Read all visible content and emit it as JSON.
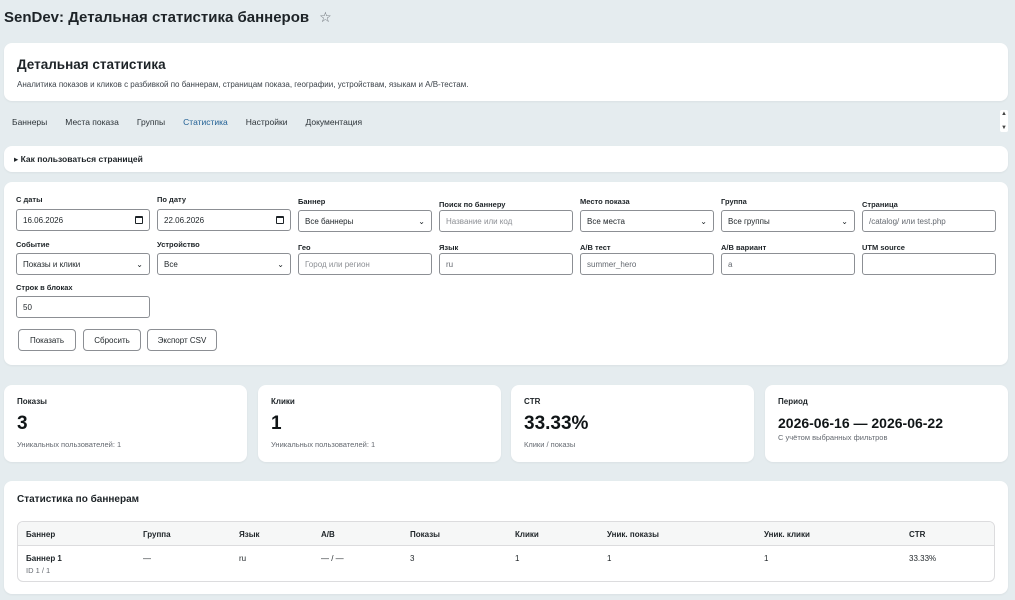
{
  "page_title": "SenDev: Детальная статистика баннеров",
  "header": {
    "title": "Детальная статистика",
    "subtitle": "Аналитика показов и кликов с разбивкой по баннерам, страницам показа, географии, устройствам, языкам и A/B-тестам."
  },
  "tabs": [
    {
      "label": "Баннеры"
    },
    {
      "label": "Места показа"
    },
    {
      "label": "Группы"
    },
    {
      "label": "Статистика",
      "active": true
    },
    {
      "label": "Настройки"
    },
    {
      "label": "Документация"
    }
  ],
  "howto": {
    "label": "▸ Как пользоваться страницей"
  },
  "filters": {
    "date_from": {
      "label": "С даты",
      "value": "16.06.2026"
    },
    "date_to": {
      "label": "По дату",
      "value": "22.06.2026"
    },
    "banner": {
      "label": "Баннер",
      "value": "Все баннеры"
    },
    "banner_search": {
      "label": "Поиск по баннеру",
      "placeholder": "Название или код"
    },
    "place": {
      "label": "Место показа",
      "value": "Все места"
    },
    "group": {
      "label": "Группа",
      "value": "Все группы"
    },
    "page": {
      "label": "Страница",
      "placeholder": "/catalog/ или test.php"
    },
    "event": {
      "label": "Событие",
      "value": "Показы и клики"
    },
    "device": {
      "label": "Устройство",
      "value": "Все"
    },
    "geo": {
      "label": "Гео",
      "placeholder": "Город или регион"
    },
    "lang": {
      "label": "Язык",
      "value": "ru"
    },
    "ab_test": {
      "label": "A/B тест",
      "value": "summer_hero"
    },
    "ab_variant": {
      "label": "A/B вариант",
      "value": "a"
    },
    "utm_source": {
      "label": "UTM source",
      "value": ""
    },
    "rows": {
      "label": "Строк в блоках",
      "value": "50"
    }
  },
  "buttons": {
    "show": "Показать",
    "reset": "Сбросить",
    "export": "Экспорт CSV"
  },
  "stats": {
    "impressions": {
      "label": "Показы",
      "value": "3",
      "note": "Уникальных пользователей: 1"
    },
    "clicks": {
      "label": "Клики",
      "value": "1",
      "note": "Уникальных пользователей: 1"
    },
    "ctr": {
      "label": "CTR",
      "value": "33.33%",
      "note": "Клики / показы"
    },
    "period": {
      "label": "Период",
      "value": "2026-06-16 — 2026-06-22",
      "note": "С учётом выбранных фильтров"
    }
  },
  "banner_table": {
    "title": "Статистика по баннерам",
    "columns": [
      "Баннер",
      "Группа",
      "Язык",
      "A/B",
      "Показы",
      "Клики",
      "Уник. показы",
      "Уник. клики",
      "CTR"
    ],
    "rows": [
      {
        "name": "Баннер 1",
        "id": "ID 1 / 1",
        "group": "—",
        "lang": "ru",
        "ab": "— / —",
        "impressions": "3",
        "clicks": "1",
        "uniq_impressions": "1",
        "uniq_clicks": "1",
        "ctr": "33.33%"
      }
    ]
  }
}
